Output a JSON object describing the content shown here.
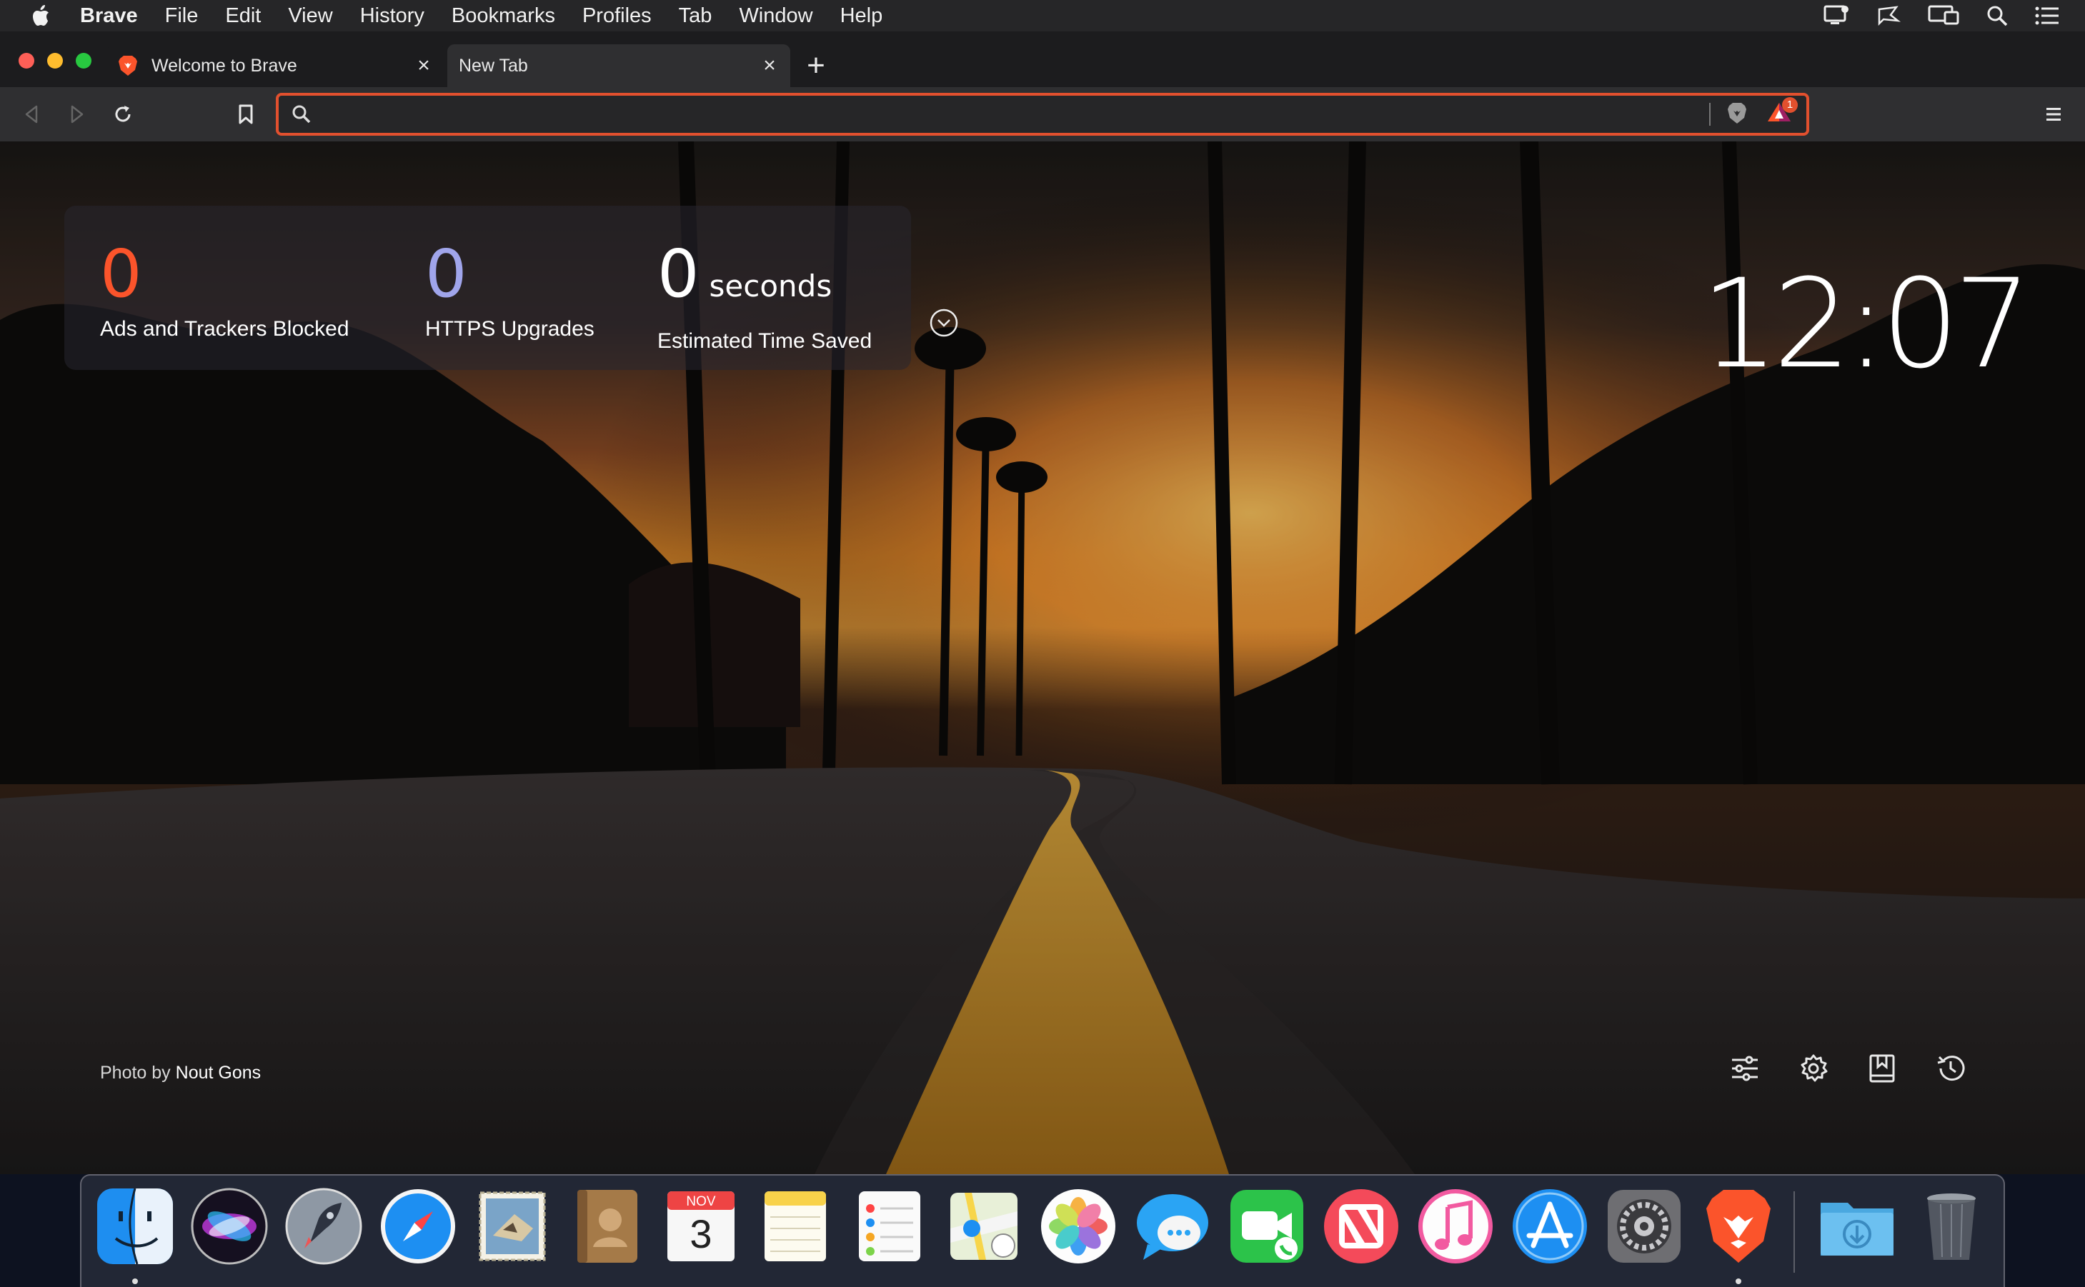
{
  "menubar": {
    "app_name": "Brave",
    "items": [
      "File",
      "Edit",
      "View",
      "History",
      "Bookmarks",
      "Profiles",
      "Tab",
      "Window",
      "Help"
    ],
    "right_icons": [
      "notification-display-icon",
      "feedback-icon",
      "screen-mirroring-icon",
      "spotlight-search-icon",
      "notification-center-icon"
    ]
  },
  "tabs": [
    {
      "title": "Welcome to Brave",
      "favicon": "brave-lion-icon",
      "active": false
    },
    {
      "title": "New Tab",
      "active": true
    }
  ],
  "toolbar": {
    "url_value": "",
    "url_placeholder": "",
    "rewards_badge": "1"
  },
  "stats": {
    "ads_blocked": {
      "value": "0",
      "label": "Ads and Trackers Blocked",
      "color": "#fb542b"
    },
    "https_upgrades": {
      "value": "0",
      "label": "HTTPS Upgrades",
      "color": "#a0a5eb"
    },
    "time_saved": {
      "value": "0",
      "unit": "seconds",
      "label": "Estimated Time Saved",
      "color": "#ffffff"
    }
  },
  "clock": "12:07",
  "photo_credit": {
    "prefix": "Photo by",
    "author": "Nout Gons"
  },
  "ntp_actions": [
    "customize-icon",
    "settings-icon",
    "bookmarks-icon",
    "history-icon"
  ],
  "dock": {
    "apps": [
      "Finder",
      "Siri",
      "Launchpad",
      "Safari",
      "Mail",
      "Contacts",
      "Calendar",
      "Notes",
      "Reminders",
      "Maps",
      "Photos",
      "Messages",
      "FaceTime",
      "News",
      "Music",
      "App Store",
      "System Preferences",
      "Brave Browser"
    ],
    "calendar_month": "NOV",
    "calendar_day": "3",
    "extras": [
      "Downloads",
      "Trash"
    ]
  },
  "colors": {
    "accent": "#e2502e",
    "menubar_bg": "#262628",
    "toolbar_bg": "#2f2f31"
  }
}
